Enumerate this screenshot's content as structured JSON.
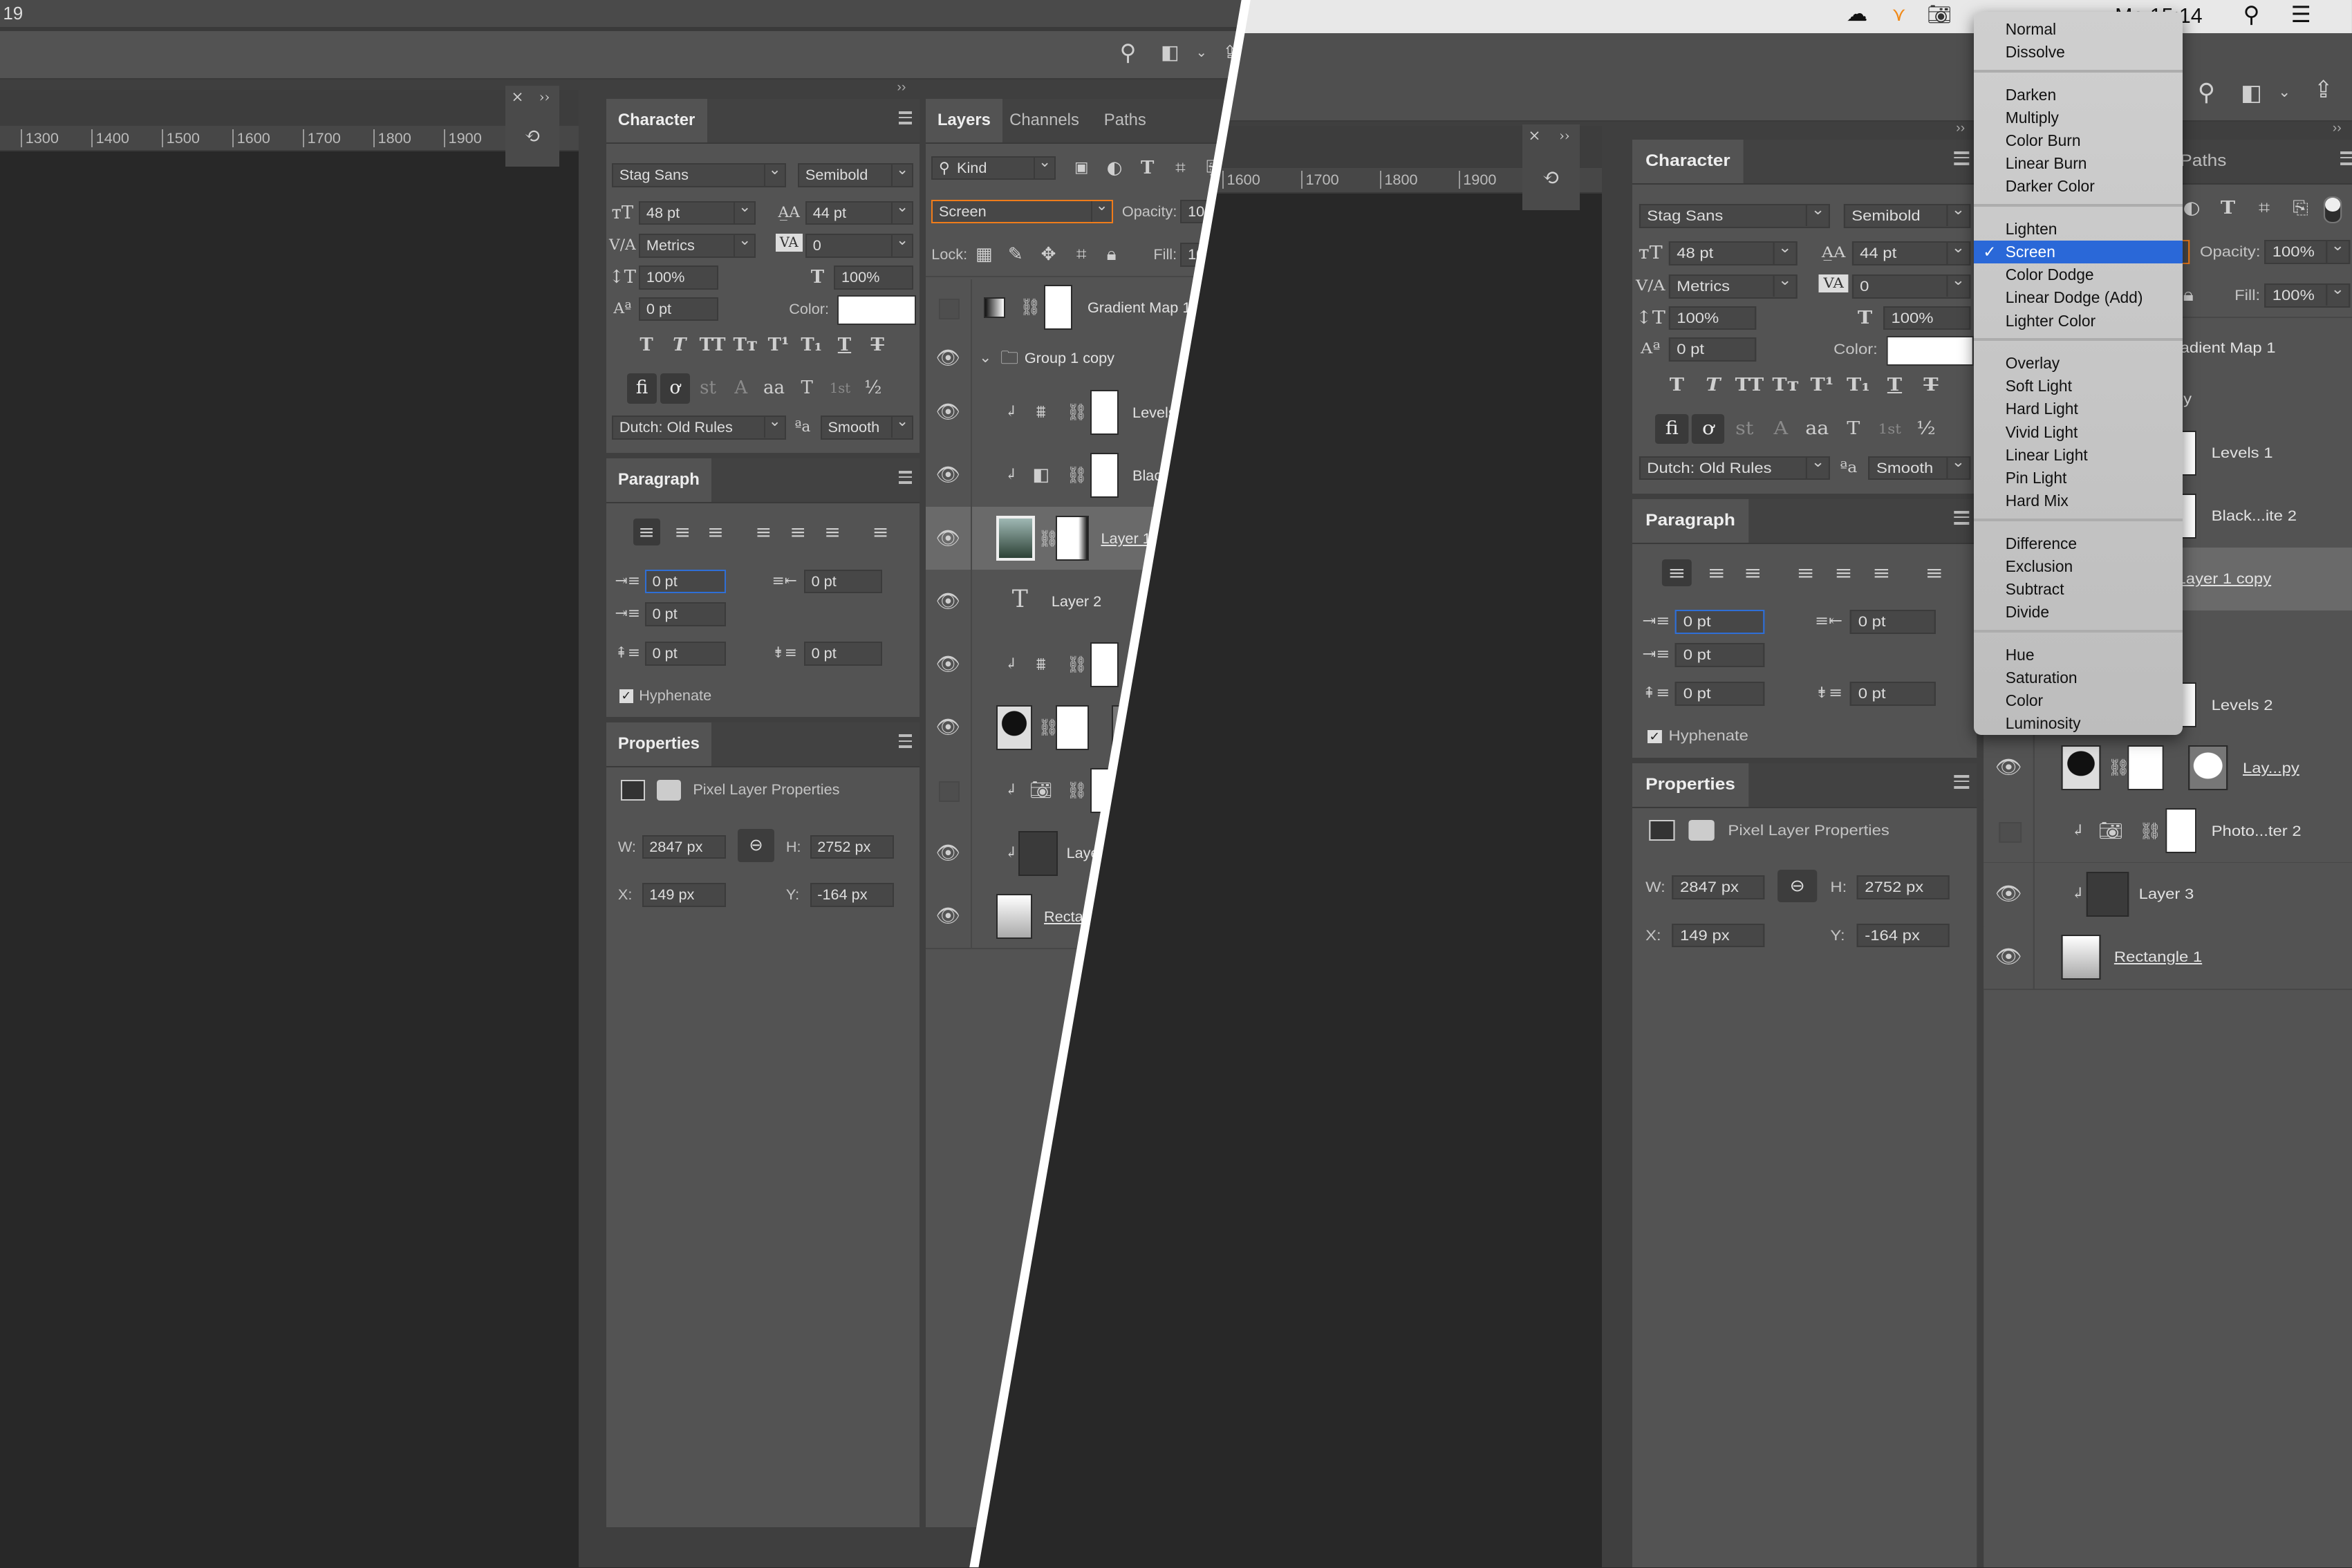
{
  "left_window": {
    "title_fragment": "19",
    "ruler_ticks": [
      "1300",
      "1400",
      "1500",
      "1600",
      "1700",
      "1800",
      "1900"
    ]
  },
  "right_window": {
    "menubar": {
      "clock": "Mo 15:14"
    },
    "ruler_ticks": [
      "1600",
      "1700",
      "1800",
      "1900"
    ]
  },
  "character": {
    "tab": "Character",
    "font_family": "Stag Sans",
    "font_style": "Semibold",
    "font_size": "48 pt",
    "leading": "44 pt",
    "kerning": "Metrics",
    "tracking": "0",
    "vertical_scale": "100%",
    "horizontal_scale": "100%",
    "baseline_shift": "0 pt",
    "color_label": "Color:",
    "text_color": "#ffffff",
    "style_buttons": [
      "T",
      "T",
      "TT",
      "Tт",
      "T¹",
      "T₁",
      "T",
      "T"
    ],
    "opentype_buttons": [
      "fi",
      "ơ",
      "st",
      "A",
      "aa",
      "T",
      "1st",
      "½"
    ],
    "language": "Dutch: Old Rules",
    "antialias": "Smooth"
  },
  "paragraph": {
    "tab": "Paragraph",
    "indent_left": "0 pt",
    "indent_right": "0 pt",
    "indent_first": "0 pt",
    "space_before": "0 pt",
    "space_after": "0 pt",
    "hyphenate_label": "Hyphenate",
    "hyphenate": true
  },
  "properties": {
    "tab": "Properties",
    "kind": "Pixel Layer Properties",
    "w_label": "W:",
    "w": "2847 px",
    "h_label": "H:",
    "h": "2752 px",
    "x_label": "X:",
    "x": "149 px",
    "y_label": "Y:",
    "y": "-164 px"
  },
  "layers": {
    "tabs": [
      "Layers",
      "Channels",
      "Paths"
    ],
    "filter": "Kind",
    "blend_mode": "Screen",
    "opacity_label": "Opacity:",
    "opacity": "100%",
    "lock_label": "Lock:",
    "fill_label": "Fill:",
    "fill": "100%",
    "accent": "#f07c1a",
    "rows": [
      {
        "name": "Gradient Map 1",
        "kind": "gradient",
        "visible": false
      },
      {
        "name": "Group 1 copy",
        "kind": "group",
        "visible": true
      },
      {
        "name": "Levels 1",
        "kind": "levels",
        "visible": true,
        "clipped": true
      },
      {
        "name": "Black...ite 2",
        "kind": "bw",
        "visible": true,
        "clipped": true
      },
      {
        "name": "Layer 1 copy",
        "kind": "photo",
        "visible": true,
        "selected": true,
        "underline": true
      },
      {
        "name": "Layer 2",
        "kind": "text",
        "visible": true
      },
      {
        "name": "Levels 2",
        "kind": "levels",
        "visible": true,
        "clipped": true
      },
      {
        "name": "Lay...py",
        "kind": "silhouette",
        "visible": true,
        "underline": true
      },
      {
        "name": "Photo...ter 2",
        "kind": "photofilter",
        "visible": false,
        "clipped": true
      },
      {
        "name": "Layer 3",
        "kind": "texture",
        "visible": true,
        "clipped": true
      },
      {
        "name": "Rectangle 1",
        "kind": "shape",
        "visible": true,
        "underline": true
      }
    ]
  },
  "blend_menu": {
    "selected": "Screen",
    "groups": [
      [
        "Normal",
        "Dissolve"
      ],
      [
        "Darken",
        "Multiply",
        "Color Burn",
        "Linear Burn",
        "Darker Color"
      ],
      [
        "Lighten",
        "Screen",
        "Color Dodge",
        "Linear Dodge (Add)",
        "Lighter Color"
      ],
      [
        "Overlay",
        "Soft Light",
        "Hard Light",
        "Vivid Light",
        "Linear Light",
        "Pin Light",
        "Hard Mix"
      ],
      [
        "Difference",
        "Exclusion",
        "Subtract",
        "Divide"
      ],
      [
        "Hue",
        "Saturation",
        "Color",
        "Luminosity"
      ]
    ],
    "highlight": "#2a68d8"
  }
}
